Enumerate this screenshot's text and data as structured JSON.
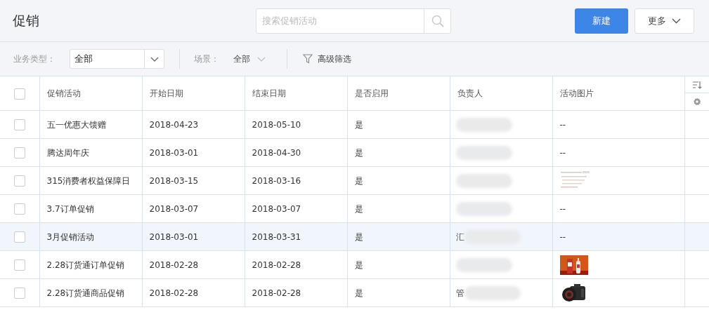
{
  "page_title": "促销",
  "search": {
    "placeholder": "搜索促销活动"
  },
  "buttons": [
    {
      "kind": "primary",
      "label": "新建"
    },
    {
      "kind": "dropdown",
      "label": "更多"
    }
  ],
  "filters": {
    "business_type": {
      "label": "业务类型：",
      "value": "全部"
    },
    "scene": {
      "label": "场景：",
      "value": "全部"
    },
    "advanced": "高级筛选"
  },
  "table": {
    "select_all_checked": false,
    "columns": [
      "促销活动",
      "开始日期",
      "结束日期",
      "是否启用",
      "负责人",
      "活动图片"
    ],
    "rows": [
      {
        "checked": false,
        "selected": false,
        "name": "五一优惠大馈赠",
        "start": "2018-04-23",
        "end": "2018-05-10",
        "enabled": "是",
        "owner": {
          "blurred": true
        },
        "image": {
          "text": "--"
        }
      },
      {
        "checked": false,
        "selected": false,
        "name": "腾达周年庆",
        "start": "2018-03-01",
        "end": "2018-04-30",
        "enabled": "是",
        "owner": {
          "blurred": true
        },
        "image": {
          "text": "--"
        }
      },
      {
        "checked": false,
        "selected": false,
        "name": "315消费者权益保障日",
        "start": "2018-03-15",
        "end": "2018-03-16",
        "enabled": "是",
        "owner": {
          "blurred": true
        }
      },
      {
        "checked": false,
        "selected": false,
        "name": "3.7订单促销",
        "start": "2018-03-07",
        "end": "2018-03-07",
        "enabled": "是",
        "owner": {
          "blurred": true
        },
        "image": {
          "text": "--"
        }
      },
      {
        "checked": false,
        "selected": true,
        "name": "3月促销活动",
        "start": "2018-03-01",
        "end": "2018-03-31",
        "enabled": "是",
        "owner": {
          "text": "汇",
          "blurred": true
        },
        "image": {
          "text": "--"
        }
      },
      {
        "checked": false,
        "selected": false,
        "name": "2.28订货通订单促销",
        "start": "2018-02-28",
        "end": "2018-02-28",
        "enabled": "是",
        "owner": {
          "blurred": true
        }
      },
      {
        "checked": false,
        "selected": false,
        "name": "2.28订货通商品促销",
        "start": "2018-02-28",
        "end": "2018-02-28",
        "enabled": "是",
        "owner": {
          "text": "管",
          "blurred": true
        }
      }
    ]
  }
}
